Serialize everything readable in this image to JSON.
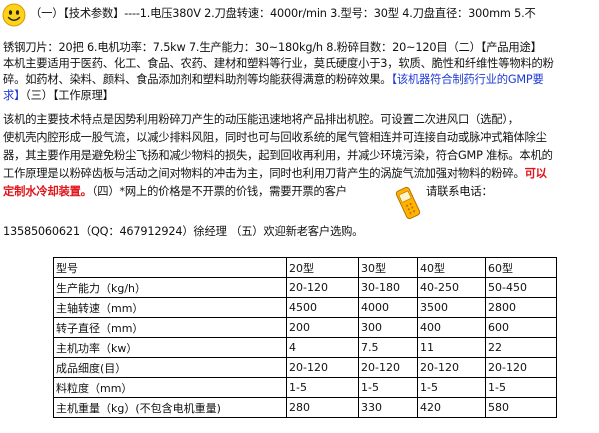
{
  "line1": "（一）【技术参数】----1.电压380V  2.刀盘转速：4000r/min  3.型号：30型 4.刀盘直径：300mm  5.不",
  "line2": "锈钢刀片：20把  6.电机功率：7.5kw  7.生产能力：30~180kg/h      8.粉碎目数：20~120目（二）【产品用途】",
  "line3": "本机主要适用于医药、化工、食品、农药、建材和塑料等行业，莫氏硬度小于3，软质、脆性和纤维性等物料的粉",
  "line4a": "碎。如药材、染料、颜料、食品添加剂和塑料助剂等均能获得满意的粉碎效果。",
  "line4b": "【该机器符合制药行业的GMP要",
  "line5a": "求】",
  "line5b": "（三）【工作原理】",
  "line6": "        该机的主要技术特点是因势利用粉碎刀产生的动压能迅速地将产品排出机腔。可设置二次进风口（选配），",
  "line7": "使机壳内腔形成一股气流，以减少排料风阻，同时也可与回收系统的尾气管相连并可连接自动或脉冲式箱体除尘",
  "line8": "器，其主要作用是避免粉尘飞扬和减少物料的损失，起到回收再利用，并减少环境污染，符合GMP 准标。本机的",
  "line9": "工作原理是以粉碎齿板与活动之间对物料的冲击为主，同时也利用刀背产生的涡旋气流加强对物料的粉碎。",
  "line9red": "可以",
  "line10red": "定制水冷却装置。",
  "line10": "（四）*网上的价格是不开票的价钱，需要开票的客户",
  "line10b": "请联系电话：",
  "line11": "13585060621（QQ：467912924）徐经理  （五）欢迎新老客户选购。",
  "icons": {
    "smiley": "smiley-icon",
    "phone": "mobile-phone-icon"
  },
  "table": {
    "header": [
      "型号",
      "20型",
      "30型",
      "40型",
      "60型"
    ],
    "rows": [
      [
        "生产能力（kg/h）",
        "20-120",
        "30-180",
        "40-250",
        "50-450"
      ],
      [
        "主轴转速（mm）",
        "4500",
        "4000",
        "3500",
        "2800"
      ],
      [
        "转子直径（mm）",
        "200",
        "300",
        "400",
        "600"
      ],
      [
        "主机功率（kw）",
        "4",
        "7.5",
        "11",
        "22"
      ],
      [
        "成品细度(目）",
        "20-120",
        "20-120",
        "20-120",
        "20-120"
      ],
      [
        "料粒度（mm）",
        "1-5",
        "1-5",
        "1-5",
        "1-5"
      ],
      [
        "主机重量（kg）(不包含电机重量)",
        "280",
        "330",
        "420",
        "580"
      ]
    ]
  }
}
